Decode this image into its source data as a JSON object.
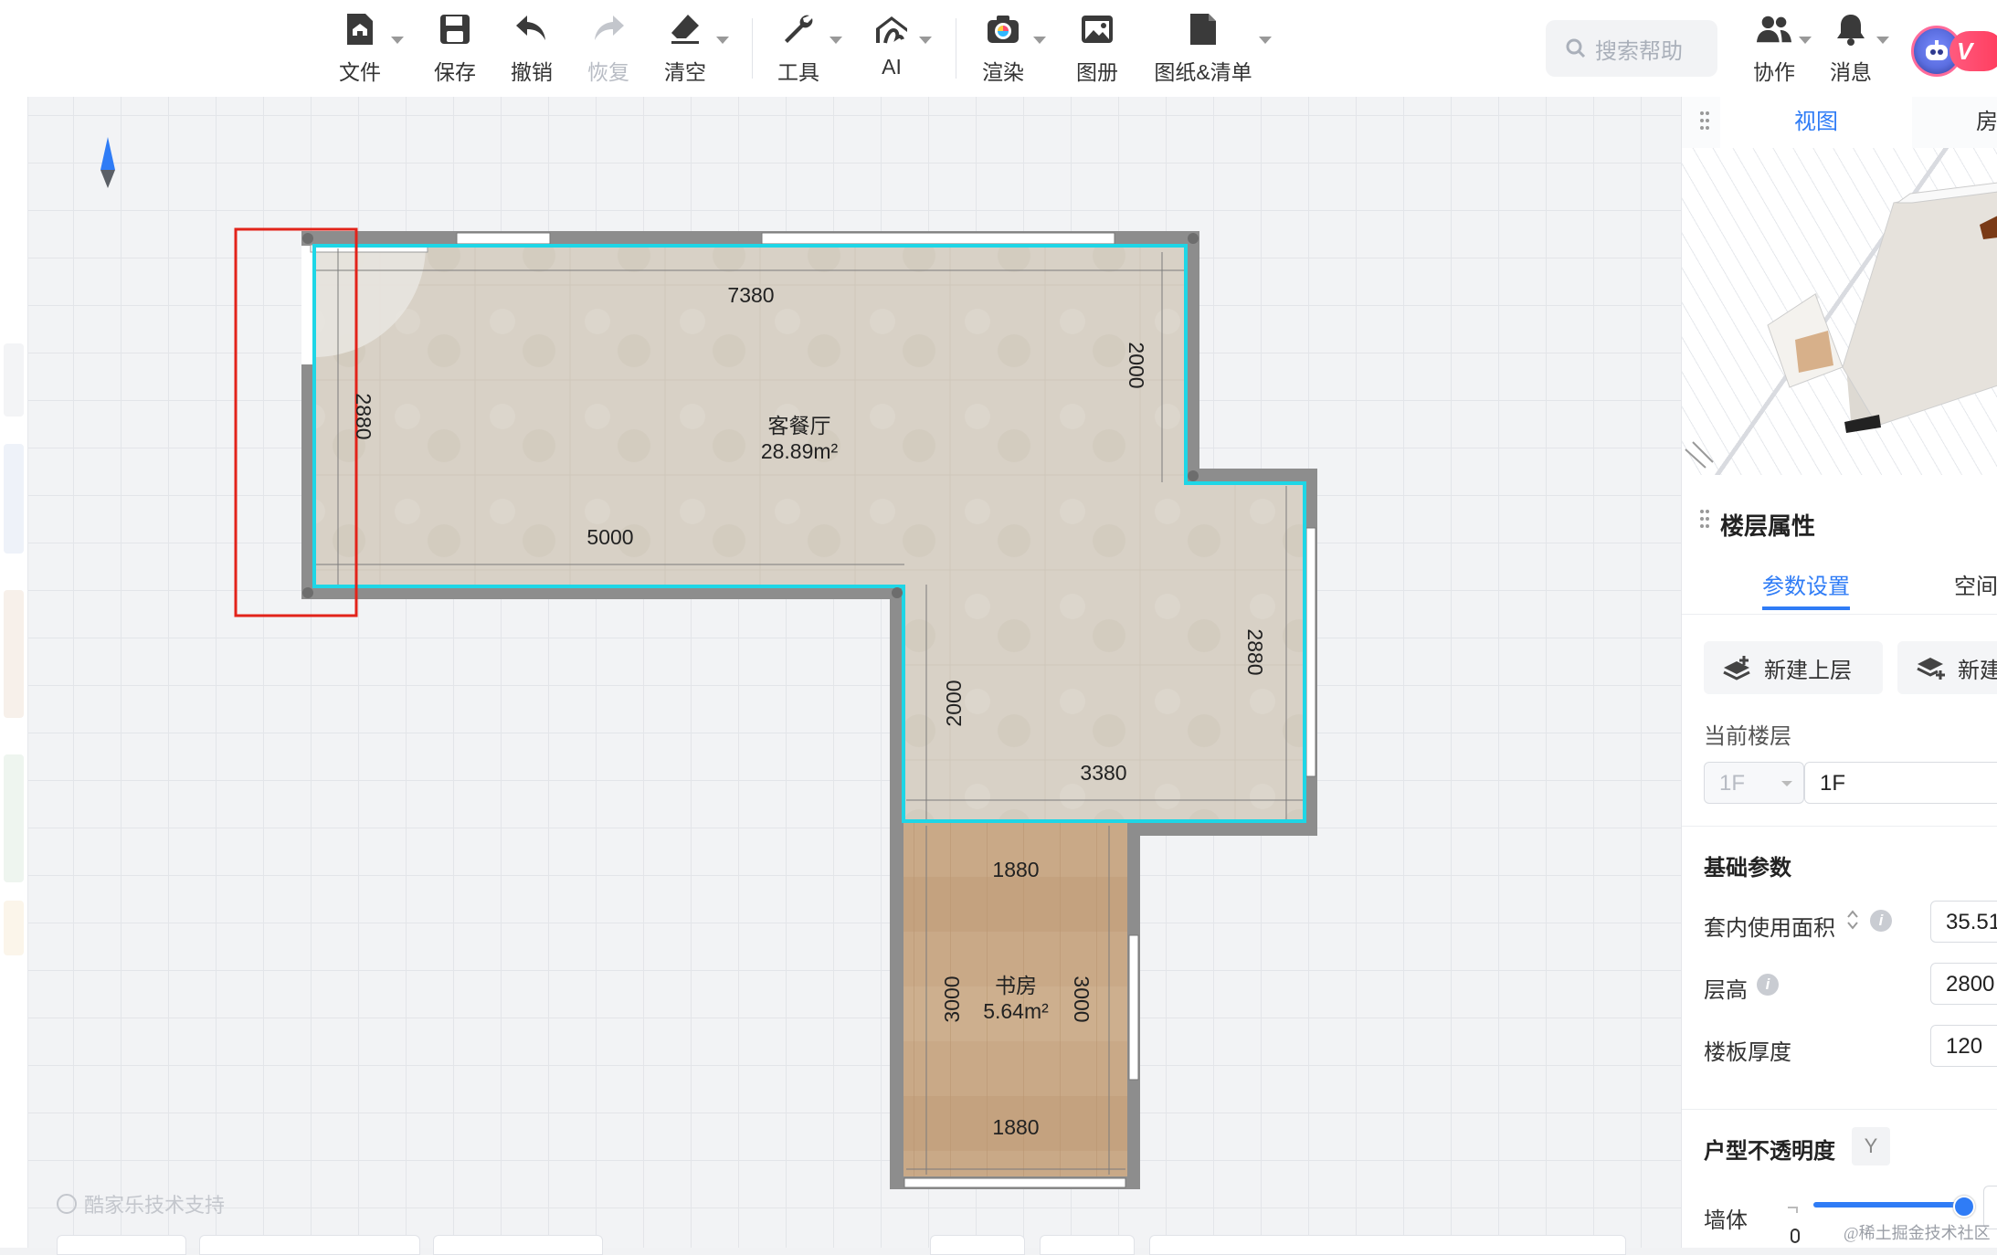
{
  "toolbar": {
    "file": "文件",
    "save": "保存",
    "undo": "撤销",
    "redo": "恢复",
    "clear": "清空",
    "tools": "工具",
    "ai": "AI",
    "render": "渲染",
    "album": "图册",
    "drawings": "图纸&清单",
    "search_placeholder": "搜索帮助",
    "collab": "协作",
    "messages": "消息",
    "vip_badge": "V"
  },
  "canvas": {
    "credit": "酷家乐技术支持",
    "rooms": [
      {
        "name": "客餐厅",
        "area": "28.89m²"
      },
      {
        "name": "书房",
        "area": "5.64m²"
      }
    ],
    "dimensions": {
      "top_width": "7380",
      "right_upper": "2000",
      "left_height": "2880",
      "inner_width": "5000",
      "inner_vertical": "2000",
      "right_lower": "2880",
      "bottom_width": "3380",
      "study_top": "1880",
      "study_left": "3000",
      "study_right": "3000",
      "study_bottom": "1880"
    },
    "colors": {
      "highlight_outline": "#1ed6e6",
      "selection_box": "#e2231a",
      "wall": "#8d8d8d"
    }
  },
  "right_panel": {
    "tabs": [
      "视图",
      "房"
    ],
    "floor_props_title": "楼层属性",
    "sub_tabs": [
      "参数设置",
      "空间"
    ],
    "new_upper": "新建上层",
    "new_lower": "新建",
    "current_floor_label": "当前楼层",
    "floor_select": "1F",
    "floor_name": "1F",
    "basic_params_title": "基础参数",
    "usable_area_label": "套内使用面积",
    "usable_area_value": "35.51",
    "floor_height_label": "层高",
    "floor_height_value": "2800",
    "slab_thickness_label": "楼板厚度",
    "slab_thickness_value": "120",
    "opacity_title": "户型不透明度",
    "opacity_key": "Y",
    "wall_label": "墙体",
    "wall_opacity": 0.96
  },
  "watermark": "@稀土掘金技术社区"
}
